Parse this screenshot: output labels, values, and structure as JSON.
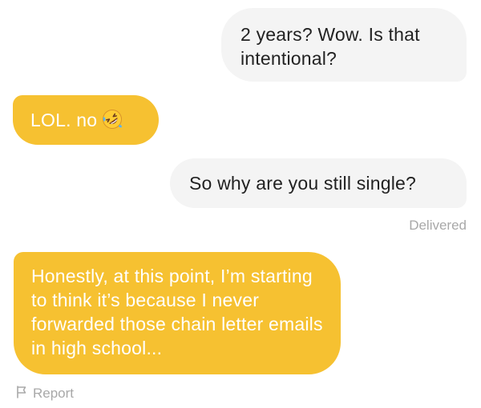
{
  "messages": [
    {
      "direction": "sent",
      "text": "2 years? Wow. Is that intentional?"
    },
    {
      "direction": "received",
      "text": "LOL. no",
      "emoji": "rolling-on-floor-laughing-emoji"
    },
    {
      "direction": "sent",
      "text": "So why are you still single?"
    },
    {
      "direction": "received",
      "text": "Honestly, at this point, I’m starting to think it’s because I never forwarded those chain letter emails in high school..."
    }
  ],
  "status": {
    "delivered": "Delivered"
  },
  "report": {
    "label": "Report",
    "icon": "flag-icon"
  },
  "colors": {
    "received_bubble": "#f6c131",
    "sent_bubble": "#f4f4f4",
    "received_text": "#ffffff",
    "sent_text": "#222222",
    "meta_text": "#a8a8a8"
  }
}
